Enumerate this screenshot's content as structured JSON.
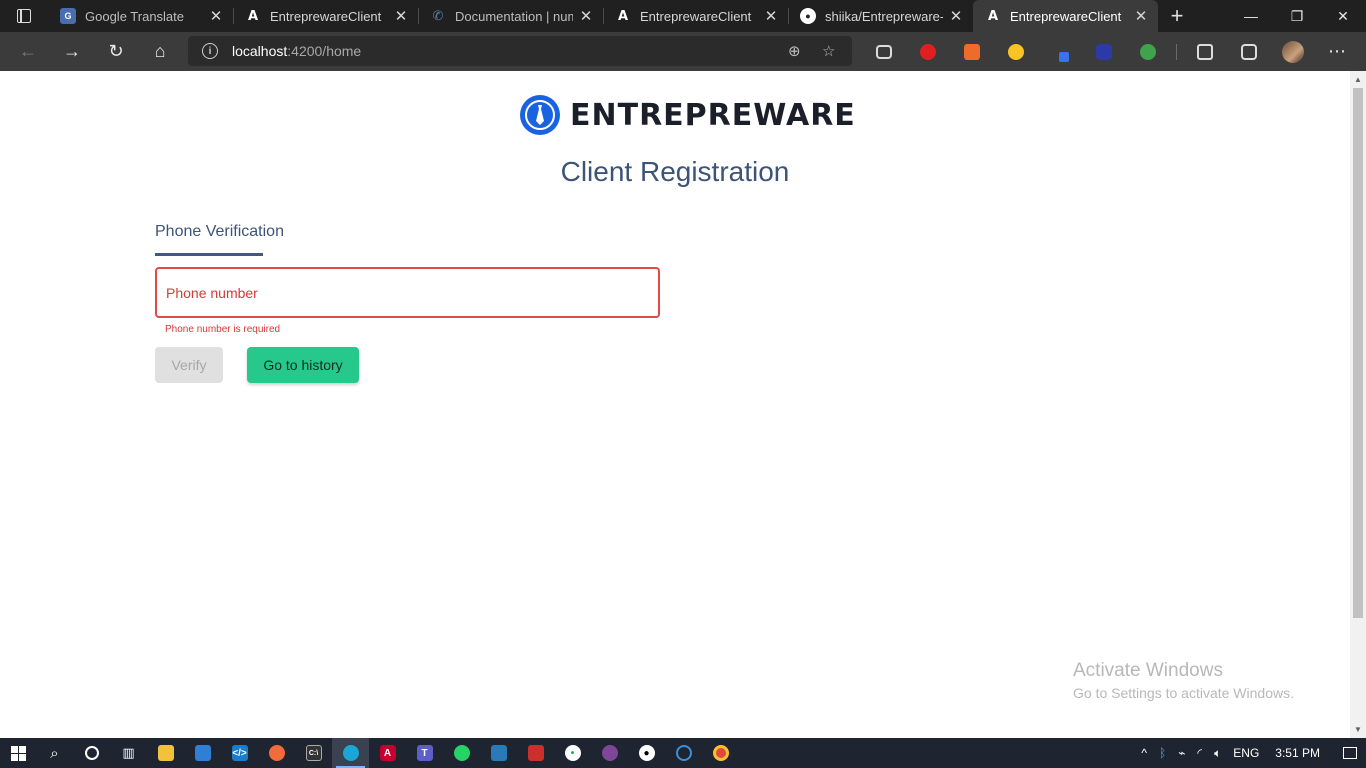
{
  "browser": {
    "tabs": [
      {
        "title": "Google Translate",
        "icon": "google-translate-icon",
        "active": false
      },
      {
        "title": "EntreprewareClient",
        "icon": "angular-icon",
        "active": false
      },
      {
        "title": "Documentation | num",
        "icon": "phone-icon",
        "active": false
      },
      {
        "title": "EntreprewareClient",
        "icon": "angular-icon",
        "active": false
      },
      {
        "title": "shiika/Entrepreware-ta",
        "icon": "github-icon",
        "active": false
      },
      {
        "title": "EntreprewareClient",
        "icon": "angular-icon",
        "active": true
      }
    ],
    "address": {
      "host": "localhost",
      "rest": ":4200/home"
    }
  },
  "page": {
    "brand": "ENTREPREWARE",
    "title": "Client Registration",
    "step_label": "Phone Verification",
    "phone": {
      "placeholder": "Phone number",
      "value": "",
      "error": "Phone number is required"
    },
    "verify_label": "Verify",
    "history_label": "Go to history"
  },
  "watermark": {
    "line1": "Activate Windows",
    "line2": "Go to Settings to activate Windows."
  },
  "taskbar": {
    "language": "ENG",
    "time": "3:51 PM"
  },
  "colors": {
    "accent_green": "#27c88b",
    "error_red": "#e24a48",
    "title_blue": "#3e5378",
    "brand_blue": "#1a63e0"
  }
}
